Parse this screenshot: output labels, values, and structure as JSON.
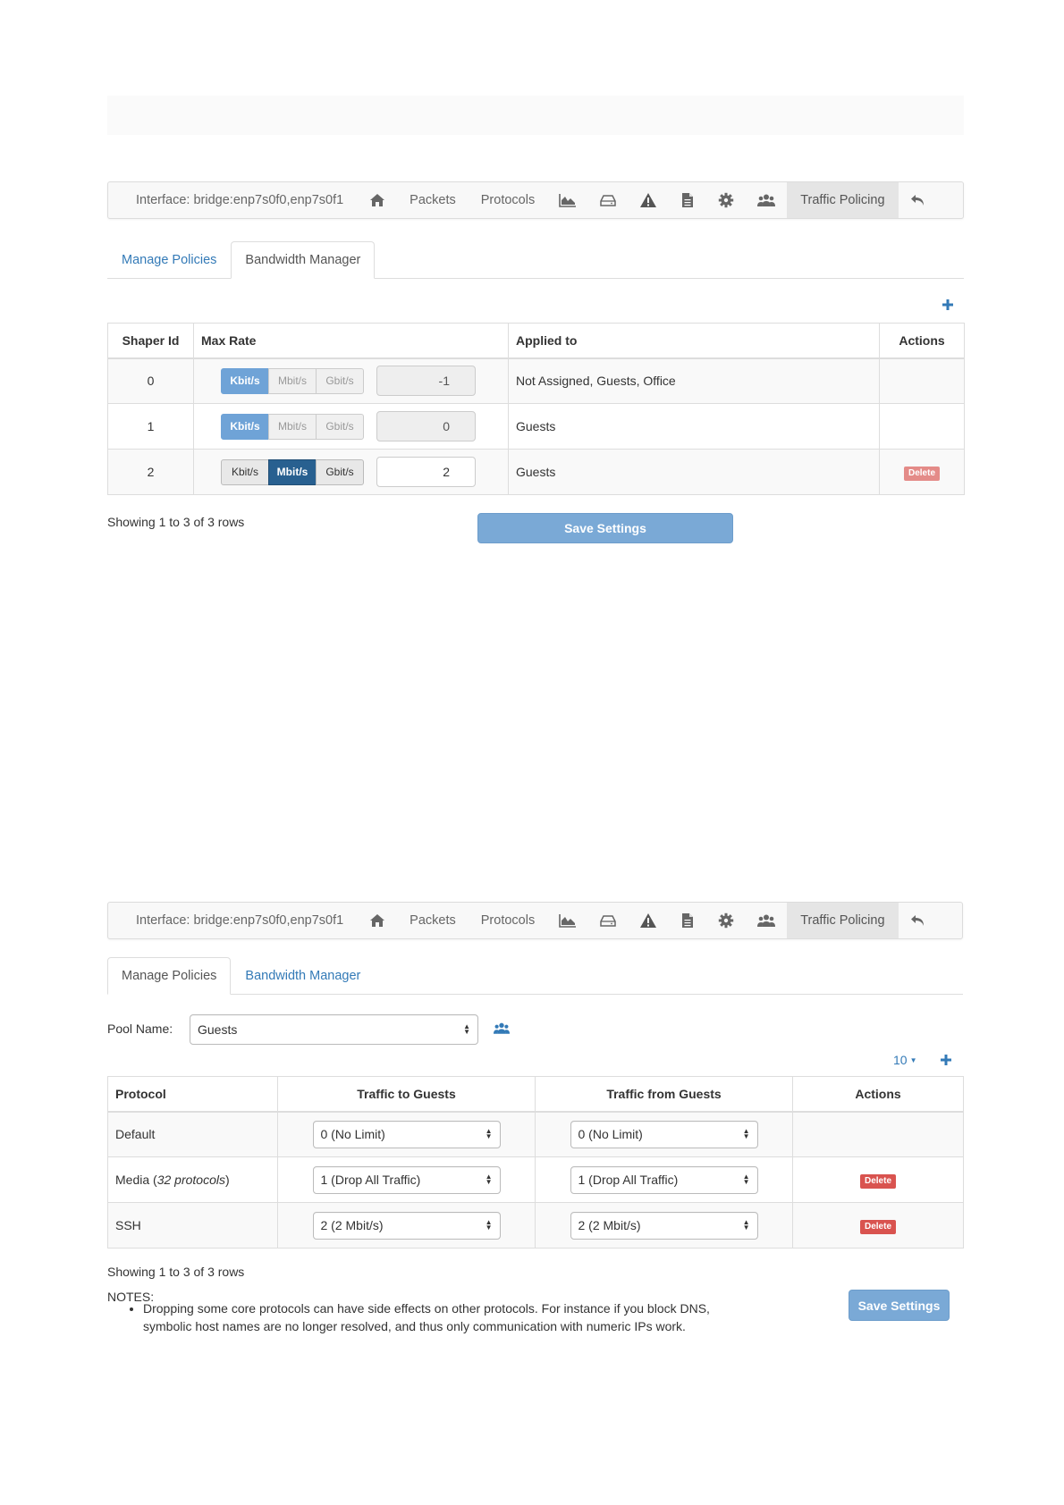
{
  "page": {
    "top_section": {
      "navbar": {
        "interface": "Interface: bridge:enp7s0f0,enp7s0f1",
        "packets": "Packets",
        "protocols": "Protocols",
        "traffic_policing": "Traffic Policing",
        "icons": [
          "home-icon",
          "area-chart-icon",
          "hdd-icon",
          "warning-icon",
          "file-icon",
          "gear-icon",
          "users-icon",
          "undo-icon"
        ]
      },
      "tabs": {
        "manage": "Manage Policies",
        "bandwidth": "Bandwidth Manager",
        "active": "bandwidth"
      },
      "add_icon": "plus-icon",
      "table": {
        "headers": [
          "Shaper Id",
          "Max Rate",
          "Applied to",
          "Actions"
        ],
        "units": [
          "Kbit/s",
          "Mbit/s",
          "Gbit/s"
        ],
        "rows": [
          {
            "id": "0",
            "selected_unit": "Kbit/s",
            "rate": "-1",
            "applied": "Not Assigned, Guests, Office",
            "action": ""
          },
          {
            "id": "1",
            "selected_unit": "Kbit/s",
            "rate": "0",
            "applied": "Guests",
            "action": ""
          },
          {
            "id": "2",
            "selected_unit": "Mbit/s",
            "rate": "2",
            "applied": "Guests",
            "action": "Delete"
          }
        ]
      },
      "showing": "Showing 1 to 3 of 3 rows",
      "save": "Save Settings"
    },
    "bottom_section": {
      "navbar": {
        "interface": "Interface: bridge:enp7s0f0,enp7s0f1",
        "packets": "Packets",
        "protocols": "Protocols",
        "traffic_policing": "Traffic Policing"
      },
      "tabs": {
        "manage": "Manage Policies",
        "bandwidth": "Bandwidth Manager",
        "active": "manage"
      },
      "pool_label": "Pool Name:",
      "pool_value": "Guests",
      "page_size": "10",
      "table": {
        "headers": [
          "Protocol",
          "Traffic to Guests",
          "Traffic from Guests",
          "Actions"
        ],
        "rows": [
          {
            "protocol": "Default",
            "protocol_note": "",
            "to": "0 (No Limit)",
            "from": "0 (No Limit)",
            "action": ""
          },
          {
            "protocol": "Media",
            "protocol_note": "32 protocols",
            "to": "1 (Drop All Traffic)",
            "from": "1 (Drop All Traffic)",
            "action": "Delete"
          },
          {
            "protocol": "SSH",
            "protocol_note": "",
            "to": "2 (2 Mbit/s)",
            "from": "2 (2 Mbit/s)",
            "action": "Delete"
          }
        ]
      },
      "showing": "Showing 1 to 3 of 3 rows",
      "notes_title": "NOTES:",
      "notes": [
        "Dropping some core protocols can have side effects on other protocols. For instance if you block DNS, symbolic host names are no longer resolved, and thus only communication with numeric IPs work."
      ],
      "save": "Save Settings"
    },
    "colors": {
      "accent": "#337ab7",
      "save_button": "#7aa9d6",
      "delete": "#d9534f",
      "selected_unit": "#286090"
    }
  }
}
